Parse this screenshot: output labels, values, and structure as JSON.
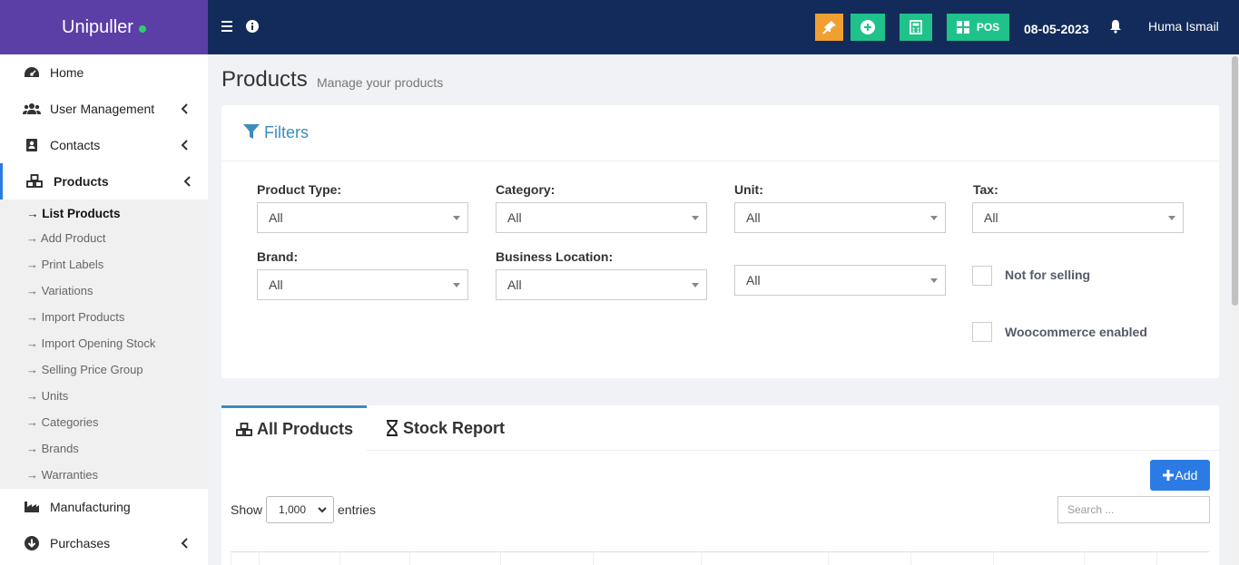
{
  "app": {
    "name": "Unipuller"
  },
  "topbar": {
    "date": "08-05-2023",
    "user": "Huma Ismail",
    "pos_label": "POS",
    "colors": {
      "background": "#122b5a",
      "brand": "#5b3ea6",
      "orange_button": "#f0a030",
      "green_button": "#1fc28a"
    }
  },
  "sidebar": {
    "items": [
      {
        "label": "Home",
        "icon": "dashboard-icon"
      },
      {
        "label": "User Management",
        "icon": "users-icon"
      },
      {
        "label": "Contacts",
        "icon": "address-book-icon"
      },
      {
        "label": "Products",
        "icon": "cubes-icon"
      },
      {
        "label": "Manufacturing",
        "icon": "industry-icon"
      },
      {
        "label": "Purchases",
        "icon": "arrow-circle-down-icon"
      }
    ],
    "submenu": [
      "→ List Products",
      "→ Add Product",
      "→ Print Labels",
      "→ Variations",
      "→ Import Products",
      "→ Import Opening Stock",
      "→ Selling Price Group",
      "→ Units",
      "→ Categories",
      "→ Brands",
      "→ Warranties"
    ]
  },
  "page": {
    "title": "Products",
    "subtitle": "Manage your products"
  },
  "filters": {
    "title": "Filters",
    "product_type": {
      "label": "Product Type:",
      "value": "All"
    },
    "category": {
      "label": "Category:",
      "value": "All"
    },
    "unit": {
      "label": "Unit:",
      "value": "All"
    },
    "tax": {
      "label": "Tax:",
      "value": "All"
    },
    "brand": {
      "label": "Brand:",
      "value": "All"
    },
    "business_location": {
      "label": "Business Location:",
      "value": "All"
    },
    "extra": {
      "value": "All"
    },
    "not_for_selling": {
      "label": "Not for selling",
      "checked": false
    },
    "woocommerce_enabled": {
      "label": "Woocommerce enabled",
      "checked": false
    }
  },
  "tabs": [
    {
      "label": "All Products",
      "icon": "cubes-icon",
      "active": true
    },
    {
      "label": "Stock Report",
      "icon": "hourglass-icon",
      "active": false
    }
  ],
  "table": {
    "add_label": "Add",
    "show_label": "Show",
    "entries_value": "1,000",
    "entries_label": "entries",
    "search_placeholder": "Search ..."
  }
}
